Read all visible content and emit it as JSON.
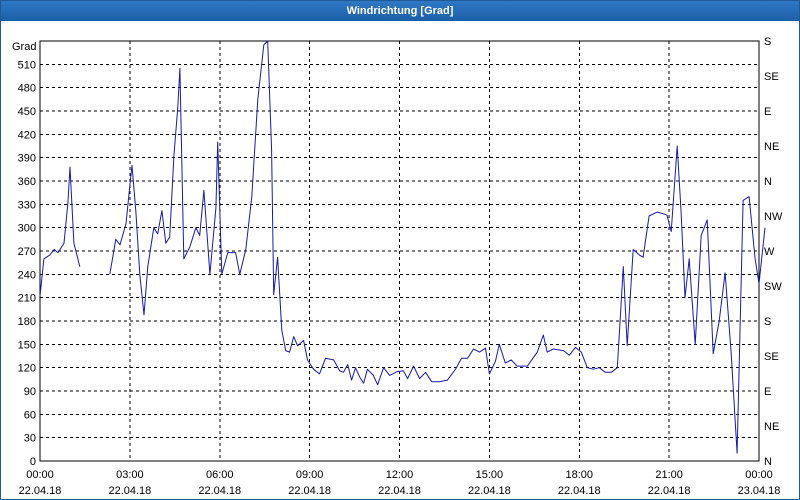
{
  "window": {
    "title": "Windrichtung [Grad]"
  },
  "colors": {
    "series": "#1a1aa8",
    "grid": "#000000",
    "titlebar": "#2a6fbb"
  },
  "chart_data": {
    "type": "line",
    "title": "Windrichtung [Grad]",
    "ylabel": "Grad",
    "ylim": [
      0,
      540
    ],
    "yticks": [
      0,
      30,
      60,
      90,
      120,
      150,
      180,
      210,
      240,
      270,
      300,
      330,
      360,
      390,
      420,
      450,
      480,
      510
    ],
    "right_axis_labels": [
      {
        "value": 0,
        "label": "N"
      },
      {
        "value": 45,
        "label": "NE"
      },
      {
        "value": 90,
        "label": "E"
      },
      {
        "value": 135,
        "label": "SE"
      },
      {
        "value": 180,
        "label": "S"
      },
      {
        "value": 225,
        "label": "SW"
      },
      {
        "value": 270,
        "label": "W"
      },
      {
        "value": 315,
        "label": "NW"
      },
      {
        "value": 360,
        "label": "N"
      },
      {
        "value": 405,
        "label": "NE"
      },
      {
        "value": 450,
        "label": "E"
      },
      {
        "value": 495,
        "label": "SE"
      },
      {
        "value": 540,
        "label": "S"
      }
    ],
    "xlim_hours": [
      0,
      24
    ],
    "xticks": [
      {
        "hour": 0,
        "time": "00:00",
        "date": "22.04.18"
      },
      {
        "hour": 3,
        "time": "03:00",
        "date": "22.04.18"
      },
      {
        "hour": 6,
        "time": "06:00",
        "date": "22.04.18"
      },
      {
        "hour": 9,
        "time": "09:00",
        "date": "22.04.18"
      },
      {
        "hour": 12,
        "time": "12:00",
        "date": "22.04.18"
      },
      {
        "hour": 15,
        "time": "15:00",
        "date": "22.04.18"
      },
      {
        "hour": 18,
        "time": "18:00",
        "date": "22.04.18"
      },
      {
        "hour": 21,
        "time": "21:00",
        "date": "22.04.18"
      },
      {
        "hour": 24,
        "time": "00:00",
        "date": "23.04.18"
      }
    ],
    "grid": true,
    "series": [
      {
        "segments": [
          [
            [
              0.0,
              212
            ],
            [
              0.13,
              260
            ],
            [
              0.33,
              265
            ],
            [
              0.47,
              272
            ],
            [
              0.6,
              268
            ],
            [
              0.8,
              280
            ],
            [
              0.93,
              332
            ],
            [
              1.0,
              378
            ],
            [
              1.13,
              280
            ],
            [
              1.33,
              250
            ]
          ],
          [
            [
              2.33,
              240
            ],
            [
              2.53,
              285
            ],
            [
              2.67,
              278
            ],
            [
              2.87,
              305
            ],
            [
              3.0,
              355
            ],
            [
              3.07,
              380
            ],
            [
              3.2,
              320
            ],
            [
              3.33,
              240
            ],
            [
              3.47,
              188
            ],
            [
              3.6,
              250
            ],
            [
              3.8,
              300
            ],
            [
              3.93,
              292
            ],
            [
              4.07,
              322
            ],
            [
              4.2,
              280
            ],
            [
              4.33,
              288
            ],
            [
              4.47,
              392
            ],
            [
              4.6,
              455
            ],
            [
              4.67,
              505
            ],
            [
              4.8,
              260
            ],
            [
              5.0,
              275
            ],
            [
              5.2,
              300
            ],
            [
              5.33,
              290
            ],
            [
              5.47,
              348
            ],
            [
              5.67,
              240
            ],
            [
              5.87,
              325
            ],
            [
              5.93,
              410
            ],
            [
              6.07,
              240
            ],
            [
              6.27,
              268
            ],
            [
              6.53,
              268
            ],
            [
              6.67,
              240
            ],
            [
              6.87,
              272
            ],
            [
              7.07,
              340
            ],
            [
              7.27,
              465
            ],
            [
              7.47,
              535
            ],
            [
              7.6,
              540
            ],
            [
              7.73,
              400
            ],
            [
              7.8,
              214
            ],
            [
              7.93,
              262
            ],
            [
              8.07,
              168
            ],
            [
              8.2,
              142
            ],
            [
              8.33,
              140
            ],
            [
              8.47,
              160
            ],
            [
              8.6,
              148
            ],
            [
              8.8,
              155
            ],
            [
              8.93,
              130
            ],
            [
              9.13,
              118
            ],
            [
              9.33,
              112
            ],
            [
              9.53,
              132
            ],
            [
              9.8,
              130
            ],
            [
              10.0,
              116
            ],
            [
              10.13,
              114
            ],
            [
              10.27,
              124
            ],
            [
              10.4,
              104
            ],
            [
              10.53,
              120
            ],
            [
              10.67,
              108
            ],
            [
              10.8,
              100
            ],
            [
              10.93,
              118
            ],
            [
              11.13,
              110
            ],
            [
              11.27,
              98
            ],
            [
              11.47,
              120
            ],
            [
              11.67,
              110
            ],
            [
              11.93,
              115
            ],
            [
              12.13,
              116
            ],
            [
              12.27,
              106
            ],
            [
              12.47,
              122
            ],
            [
              12.67,
              106
            ],
            [
              12.87,
              114
            ],
            [
              13.07,
              102
            ],
            [
              13.33,
              102
            ],
            [
              13.6,
              104
            ],
            [
              13.87,
              118
            ],
            [
              14.07,
              132
            ],
            [
              14.27,
              132
            ],
            [
              14.47,
              144
            ],
            [
              14.67,
              140
            ],
            [
              14.87,
              145
            ],
            [
              15.0,
              112
            ],
            [
              15.2,
              128
            ],
            [
              15.33,
              150
            ],
            [
              15.53,
              126
            ],
            [
              15.73,
              130
            ],
            [
              15.93,
              122
            ],
            [
              16.27,
              122
            ],
            [
              16.6,
              140
            ],
            [
              16.8,
              162
            ],
            [
              16.93,
              140
            ],
            [
              17.13,
              144
            ],
            [
              17.47,
              142
            ],
            [
              17.67,
              136
            ],
            [
              17.87,
              146
            ],
            [
              18.07,
              140
            ],
            [
              18.27,
              120
            ],
            [
              18.47,
              118
            ],
            [
              18.67,
              120
            ],
            [
              18.87,
              114
            ],
            [
              19.07,
              114
            ],
            [
              19.27,
              120
            ],
            [
              19.47,
              250
            ],
            [
              19.6,
              148
            ],
            [
              19.8,
              272
            ],
            [
              20.0,
              265
            ],
            [
              20.13,
              262
            ],
            [
              20.33,
              315
            ],
            [
              20.6,
              320
            ],
            [
              20.8,
              318
            ],
            [
              20.93,
              316
            ],
            [
              21.07,
              295
            ],
            [
              21.27,
              405
            ],
            [
              21.4,
              320
            ],
            [
              21.53,
              210
            ],
            [
              21.67,
              260
            ],
            [
              21.87,
              150
            ],
            [
              22.07,
              290
            ],
            [
              22.27,
              310
            ],
            [
              22.47,
              138
            ],
            [
              22.67,
              180
            ],
            [
              22.87,
              242
            ],
            [
              23.07,
              140
            ],
            [
              23.27,
              10
            ],
            [
              23.47,
              335
            ],
            [
              23.67,
              340
            ],
            [
              23.87,
              260
            ],
            [
              24.0,
              228
            ],
            [
              24.2,
              300
            ]
          ]
        ]
      }
    ]
  }
}
